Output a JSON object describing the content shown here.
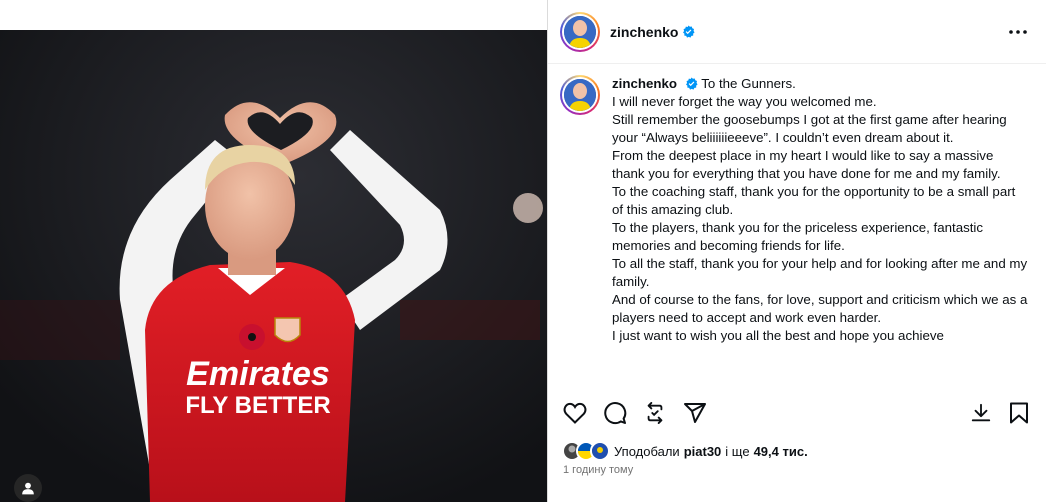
{
  "post": {
    "username": "zinchenko",
    "caption_lines": [
      "To the Gunners.",
      "I will never forget the way you welcomed me.",
      "Still remember the goosebumps I got at the first game after hearing your “Always beliiiiiieeeve”. I couldn’t even dream about it.",
      "From the deepest place in my heart I would like to say a massive thank you for everything that you have done for me and my family.",
      "To the coaching staff, thank you for the opportunity to be a small part of this amazing club.",
      "To the players, thank you for the priceless experience, fantastic memories and becoming friends for life.",
      "To all the staff, thank you for your help and for looking after me and my family.",
      "And of course to the fans, for love, support and criticism which we as a players need to accept and work even harder.",
      "I just want to wish you all the best and hope you achieve"
    ],
    "likes_prefix": "Уподобали",
    "likes_user": "piat30",
    "likes_conj": "і ще",
    "likes_count": "49,4 тис.",
    "time_ago": "1 годину тому"
  },
  "photo": {
    "shirt_sponsor_line1": "Emirates",
    "shirt_sponsor_line2": "FLY BETTER"
  },
  "icons": {
    "verified": "verified-badge-icon",
    "more": "more-options-icon",
    "like": "heart-icon",
    "comment": "comment-icon",
    "repost": "repost-icon",
    "share": "send-icon",
    "download": "download-icon",
    "save": "bookmark-icon",
    "tag": "user-tag-icon"
  },
  "colors": {
    "verified": "#0095f6",
    "text": "#0c1014",
    "muted": "#737373",
    "arsenal_red": "#db0007"
  }
}
